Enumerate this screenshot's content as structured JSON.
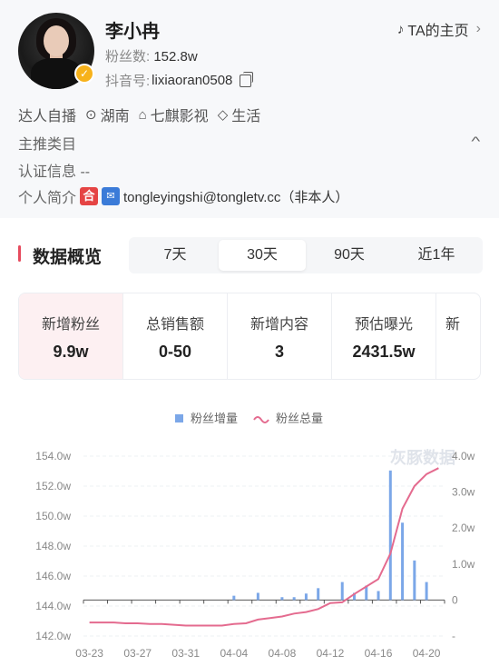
{
  "profile": {
    "name": "李小冉",
    "home_link": "TA的主页",
    "fans_label": "粉丝数:",
    "fans_value": "152.8w",
    "douyin_label": "抖音号:",
    "douyin_value": "lixiaoran0508",
    "tags": [
      "达人自播",
      "湖南",
      "七麒影视",
      "生活"
    ],
    "category_label": "主推类目",
    "cert_label": "认证信息",
    "cert_value": "--",
    "intro_label": "个人简介",
    "intro_emoji1": "合",
    "intro_text": "tongleyingshi@tongletv.cc（非本人）"
  },
  "overview": {
    "title": "数据概览",
    "periods": [
      "7天",
      "30天",
      "90天",
      "近1年"
    ],
    "active_period": 1
  },
  "metrics": [
    {
      "label": "新增粉丝",
      "value": "9.9w"
    },
    {
      "label": "总销售额",
      "value": "0-50"
    },
    {
      "label": "新增内容",
      "value": "3"
    },
    {
      "label": "预估曝光",
      "value": "2431.5w"
    },
    {
      "label": "新",
      "value": ""
    }
  ],
  "chart_data": {
    "type": "bar",
    "watermark": "灰豚数据",
    "colors": {
      "bars": "#7ba7e8",
      "line": "#e46b8f"
    },
    "legend": [
      "粉丝增量",
      "粉丝总量"
    ],
    "x_labels": [
      "03-23",
      "03-27",
      "03-31",
      "04-04",
      "04-08",
      "04-12",
      "04-16",
      "04-20"
    ],
    "x": [
      "03-23",
      "03-24",
      "03-25",
      "03-26",
      "03-27",
      "03-28",
      "03-29",
      "03-30",
      "03-31",
      "04-01",
      "04-02",
      "04-03",
      "04-04",
      "04-05",
      "04-06",
      "04-07",
      "04-08",
      "04-09",
      "04-10",
      "04-11",
      "04-12",
      "04-13",
      "04-14",
      "04-15",
      "04-16",
      "04-17",
      "04-18",
      "04-19",
      "04-20",
      "04-21"
    ],
    "left_axis": {
      "ticks": [
        "142.0w",
        "144.0w",
        "146.0w",
        "148.0w",
        "150.0w",
        "152.0w",
        "154.0w"
      ],
      "min": 142,
      "max": 154
    },
    "right_axis": {
      "ticks": [
        "-",
        "0",
        "1.0w",
        "2.0w",
        "3.0w",
        "4.0w"
      ],
      "min": -1,
      "max": 4
    },
    "series": [
      {
        "name": "粉丝增量",
        "axis": "right",
        "values": [
          0,
          0,
          0,
          0,
          0,
          0,
          0,
          0,
          0,
          0,
          0,
          0,
          0.12,
          0,
          0.2,
          0,
          0.08,
          0.08,
          0.18,
          0.33,
          0,
          0.5,
          0.2,
          0.4,
          0.25,
          3.6,
          2.15,
          1.1,
          0.5,
          0
        ]
      },
      {
        "name": "粉丝总量",
        "axis": "left",
        "values": [
          142.9,
          142.9,
          142.9,
          142.85,
          142.85,
          142.8,
          142.8,
          142.75,
          142.7,
          142.7,
          142.7,
          142.7,
          142.8,
          142.85,
          143.1,
          143.2,
          143.3,
          143.5,
          143.6,
          143.8,
          144.2,
          144.25,
          144.8,
          145.3,
          145.8,
          147.5,
          150.5,
          152.0,
          152.8,
          153.2
        ]
      }
    ]
  }
}
